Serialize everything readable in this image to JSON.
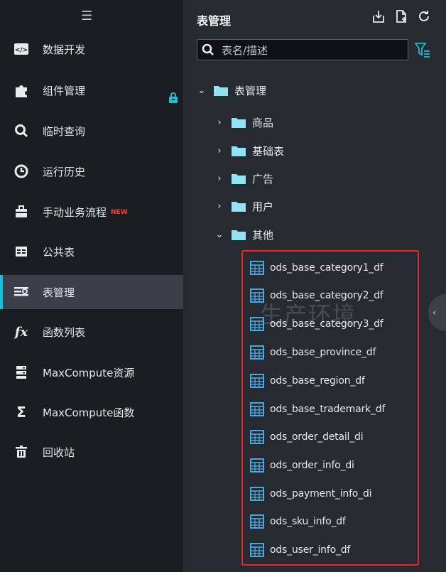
{
  "sidebar": {
    "items": [
      {
        "label": "数据开发",
        "icon": "code-icon"
      },
      {
        "label": "组件管理",
        "icon": "puzzle-icon"
      },
      {
        "label": "临时查询",
        "icon": "search-icon"
      },
      {
        "label": "运行历史",
        "icon": "clock-icon"
      },
      {
        "label": "手动业务流程",
        "icon": "briefcase-icon",
        "badge": "NEW"
      },
      {
        "label": "公共表",
        "icon": "table-grid-icon"
      },
      {
        "label": "表管理",
        "icon": "table-manage-icon"
      },
      {
        "label": "函数列表",
        "icon": "function-icon",
        "icon_text": "fx"
      },
      {
        "label": "MaxCompute资源",
        "icon": "server-icon"
      },
      {
        "label": "MaxCompute函数",
        "icon": "sigma-icon",
        "icon_text": "Σ"
      },
      {
        "label": "回收站",
        "icon": "trash-icon"
      }
    ],
    "active_index": 6,
    "accent_color": "#1bbfd3"
  },
  "panel": {
    "title": "表管理",
    "search_placeholder": "表名/描述",
    "toolbar_icons": [
      "import-icon",
      "new-file-icon",
      "refresh-icon"
    ]
  },
  "tree": {
    "root": "表管理",
    "folders": [
      "商品",
      "基础表",
      "广告",
      "用户",
      "其他"
    ],
    "expanded_folder": "其他",
    "tables": [
      "ods_base_category1_df",
      "ods_base_category2_df",
      "ods_base_category3_df",
      "ods_base_province_df",
      "ods_base_region_df",
      "ods_base_trademark_df",
      "ods_order_detail_di",
      "ods_order_info_di",
      "ods_payment_info_di",
      "ods_sku_info_df",
      "ods_user_info_df"
    ]
  },
  "watermark": "生产环境",
  "colors": {
    "sidebar_bg": "#1a1d22",
    "panel_bg": "#262a31",
    "folder": "#8fe3f4",
    "table_icon": "#4fb3f0",
    "highlight": "#e5262c"
  }
}
